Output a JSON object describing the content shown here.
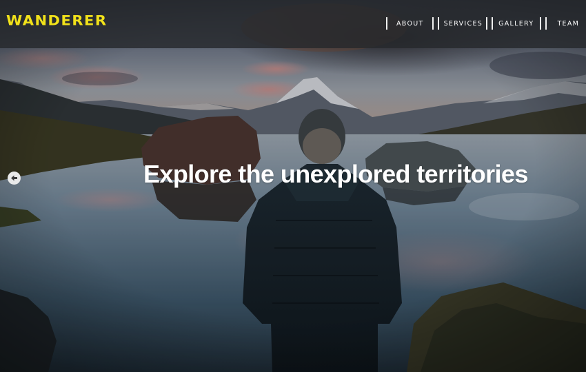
{
  "brand": {
    "logo_text": "WANDERER",
    "logo_color": "#f2e21a"
  },
  "nav": {
    "items": [
      {
        "label": "ABOUT"
      },
      {
        "label": "SERVICES"
      },
      {
        "label": "GALLERY"
      },
      {
        "label": "TEAM"
      }
    ]
  },
  "hero": {
    "headline": "Explore the unexplored territories",
    "background_image": "man-facing-mountain-lake-at-dusk",
    "prev_control_icon": "arrow-left-icon"
  }
}
